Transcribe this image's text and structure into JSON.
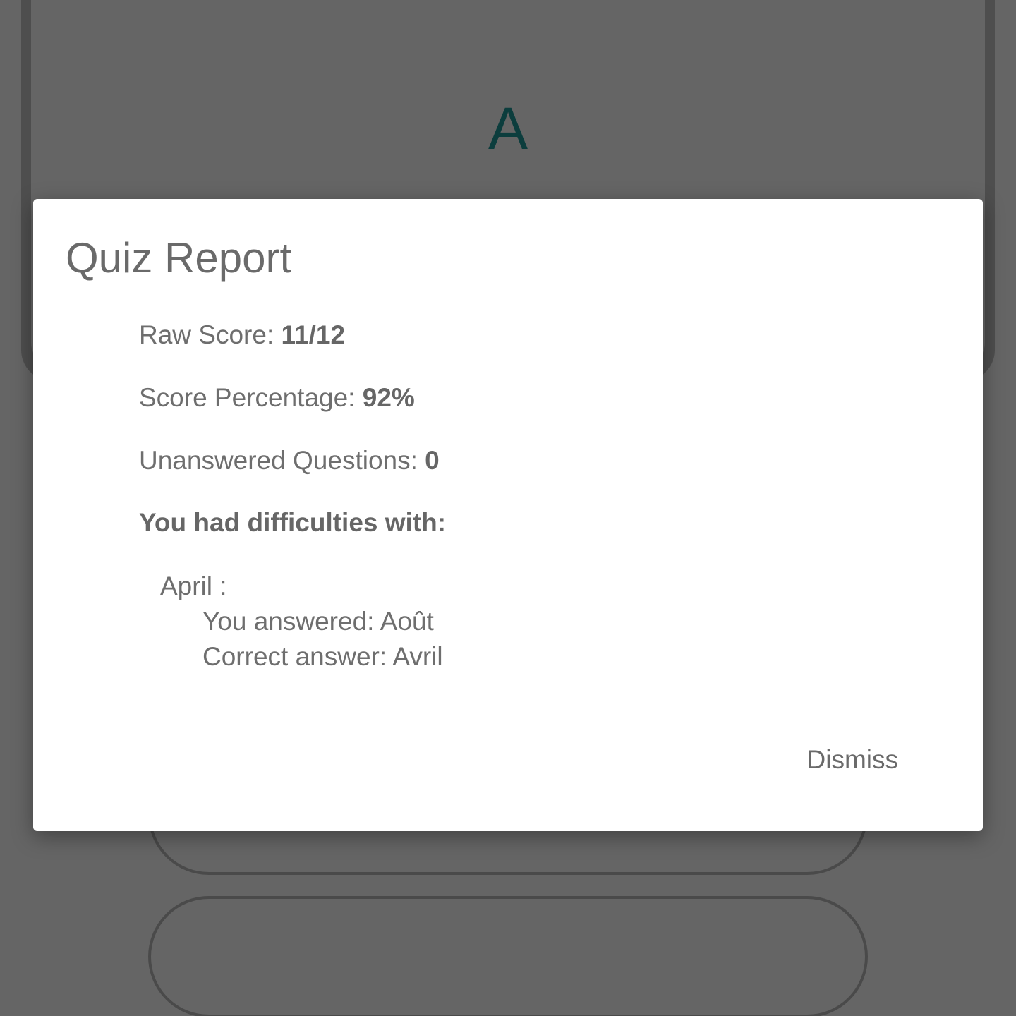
{
  "background": {
    "card_letter": "A"
  },
  "dialog": {
    "title": "Quiz Report",
    "raw_score_label": "Raw Score: ",
    "raw_score_value": "11/12",
    "percentage_label": "Score Percentage: ",
    "percentage_value": "92%",
    "unanswered_label": "Unanswered Questions: ",
    "unanswered_value": "0",
    "difficulties_heading": "You had difficulties with:",
    "difficulties": [
      {
        "term": "April :",
        "you_answered": "You answered: Août",
        "correct_answer": "Correct answer: Avril"
      }
    ],
    "dismiss_label": "Dismiss"
  },
  "colors": {
    "scrim": "#656565",
    "card_letter": "#0c3d3d",
    "dialog_bg": "#ffffff",
    "text": "#6e6e6e"
  }
}
